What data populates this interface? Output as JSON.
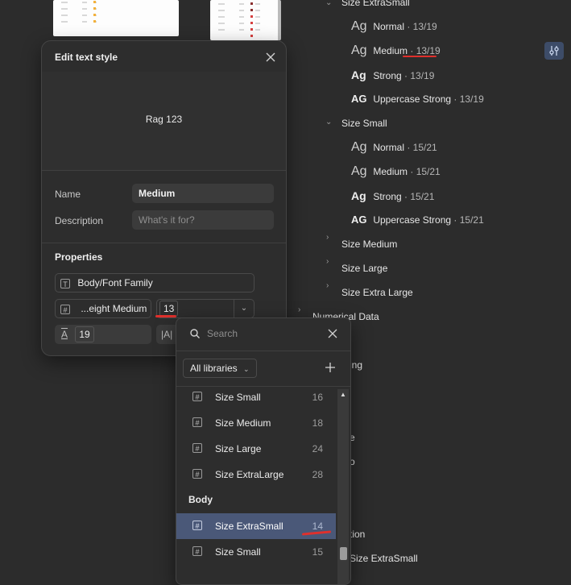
{
  "tree": {
    "group_extra_small": "Size ExtraSmall",
    "extra_small_items": [
      {
        "ag": "Ag",
        "name": "Normal",
        "meta": " · 13/19",
        "weight": "normal"
      },
      {
        "ag": "Ag",
        "name": "Medium",
        "meta": " · 13/19",
        "weight": "medium"
      },
      {
        "ag": "Ag",
        "name": "Strong",
        "meta": " · 13/19",
        "weight": "bold"
      },
      {
        "ag": "AG",
        "name": "Uppercase Strong",
        "meta": " · 13/19",
        "weight": "bold"
      }
    ],
    "group_small": "Size Small",
    "small_items": [
      {
        "ag": "Ag",
        "name": "Normal",
        "meta": " · 15/21",
        "weight": "normal"
      },
      {
        "ag": "Ag",
        "name": "Medium",
        "meta": " · 15/21",
        "weight": "medium"
      },
      {
        "ag": "Ag",
        "name": "Strong",
        "meta": " · 15/21",
        "weight": "bold"
      },
      {
        "ag": "AG",
        "name": "Uppercase Strong",
        "meta": " · 15/21",
        "weight": "bold"
      }
    ],
    "group_medium": "Size Medium",
    "group_large": "Size Large",
    "group_extra_large": "Size Extra Large",
    "numerical_data": "Numerical Data",
    "partial_1": "ing",
    "partial_2": "e",
    "partial_3": "o",
    "partial_4": "tion",
    "bottom_item": "Size ExtraSmall"
  },
  "edit_panel": {
    "title": "Edit text style",
    "preview_text": "Rag 123",
    "name_label": "Name",
    "name_value": "Medium",
    "description_label": "Description",
    "description_placeholder": "What's it for?",
    "properties_label": "Properties",
    "font_family": "Body/Font Family",
    "font_weight": "...eight Medium",
    "font_size": "13",
    "line_height": "19",
    "line_height_icon_text": "A",
    "letter_spacing_icon_text": "|A|"
  },
  "search_popup": {
    "search_placeholder": "Search",
    "library_filter": "All libraries",
    "items_top": [
      {
        "name": "Size Small",
        "value": "16"
      },
      {
        "name": "Size Medium",
        "value": "18"
      },
      {
        "name": "Size Large",
        "value": "24"
      },
      {
        "name": "Size ExtraLarge",
        "value": "28"
      }
    ],
    "section_body": "Body",
    "items_body": [
      {
        "name": "Size ExtraSmall",
        "value": "14",
        "selected": true
      },
      {
        "name": "Size Small",
        "value": "15",
        "selected": false
      }
    ]
  },
  "colors": {
    "background": "#2c2c2c",
    "panel": "#2d2d2d",
    "selected_row": "#4a5878",
    "annotation_red": "#e0302c",
    "settings_button": "#3d4c68"
  }
}
